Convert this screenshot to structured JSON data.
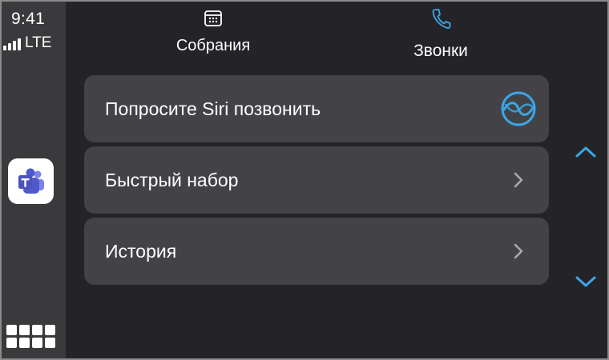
{
  "status": {
    "time": "9:41",
    "network": "LTE",
    "signal_bars": 4
  },
  "rail": {
    "app_icon": "teams-icon",
    "home_icon": "app-grid-icon"
  },
  "tabs": [
    {
      "label": "Собрания",
      "icon": "calendar-icon",
      "selected": false
    },
    {
      "label": "Звонки",
      "icon": "phone-icon",
      "selected": true
    }
  ],
  "list": {
    "items": [
      {
        "label": "Попросите Siri позвонить",
        "trailing_icon": "siri-icon"
      },
      {
        "label": "Быстрый набор",
        "trailing_icon": "chevron-right-icon"
      },
      {
        "label": "История",
        "trailing_icon": "chevron-right-icon"
      }
    ]
  },
  "scroll": {
    "up_icon": "chevron-up-icon",
    "down_icon": "chevron-down-icon"
  },
  "colors": {
    "background": "#242428",
    "rail": "#3a3a3d",
    "row": "#434347",
    "accent": "#3ba7e8",
    "teams_purple": "#5059c9"
  }
}
